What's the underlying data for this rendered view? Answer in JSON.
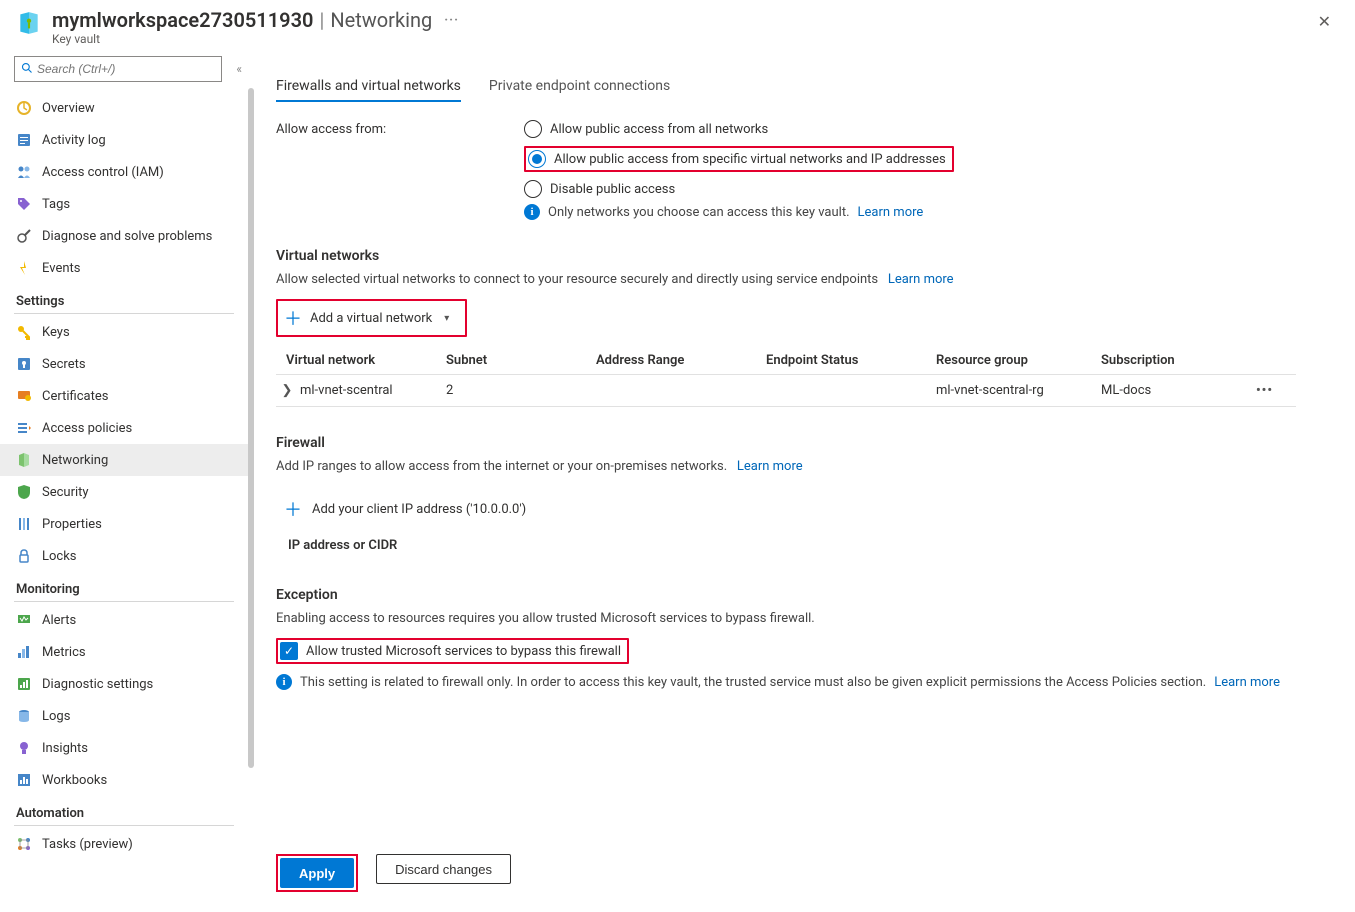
{
  "header": {
    "title": "mymlworkspace2730511930",
    "page": "Networking",
    "subtitle": "Key vault",
    "more": "···"
  },
  "sidebar": {
    "search_placeholder": "Search (Ctrl+/)",
    "top": [
      {
        "label": "Overview",
        "icon": "overview"
      },
      {
        "label": "Activity log",
        "icon": "activity"
      },
      {
        "label": "Access control (IAM)",
        "icon": "iam"
      },
      {
        "label": "Tags",
        "icon": "tags"
      },
      {
        "label": "Diagnose and solve problems",
        "icon": "diag"
      },
      {
        "label": "Events",
        "icon": "events"
      }
    ],
    "groups": [
      {
        "heading": "Settings",
        "items": [
          {
            "label": "Keys",
            "icon": "keys"
          },
          {
            "label": "Secrets",
            "icon": "secrets"
          },
          {
            "label": "Certificates",
            "icon": "certs"
          },
          {
            "label": "Access policies",
            "icon": "acp"
          },
          {
            "label": "Networking",
            "icon": "net",
            "active": true
          },
          {
            "label": "Security",
            "icon": "sec"
          },
          {
            "label": "Properties",
            "icon": "prop"
          },
          {
            "label": "Locks",
            "icon": "locks"
          }
        ]
      },
      {
        "heading": "Monitoring",
        "items": [
          {
            "label": "Alerts",
            "icon": "alerts"
          },
          {
            "label": "Metrics",
            "icon": "metrics"
          },
          {
            "label": "Diagnostic settings",
            "icon": "diagset"
          },
          {
            "label": "Logs",
            "icon": "logs"
          },
          {
            "label": "Insights",
            "icon": "insights"
          },
          {
            "label": "Workbooks",
            "icon": "workbooks"
          }
        ]
      },
      {
        "heading": "Automation",
        "items": [
          {
            "label": "Tasks (preview)",
            "icon": "tasks"
          }
        ]
      }
    ]
  },
  "tabs": {
    "firewalls": "Firewalls and virtual networks",
    "private": "Private endpoint connections"
  },
  "access": {
    "label": "Allow access from:",
    "opt_all": "Allow public access from all networks",
    "opt_specific": "Allow public access from specific virtual networks and IP addresses",
    "opt_disable": "Disable public access",
    "info": "Only networks you choose can access this key vault.",
    "learn_more": "Learn more"
  },
  "vnets": {
    "heading": "Virtual networks",
    "desc": "Allow selected virtual networks to connect to your resource securely and directly using service endpoints",
    "learn_more": "Learn more",
    "add_btn": "Add a virtual network",
    "columns": {
      "vnet": "Virtual network",
      "subnet": "Subnet",
      "range": "Address Range",
      "status": "Endpoint Status",
      "rg": "Resource group",
      "sub": "Subscription"
    },
    "rows": [
      {
        "vnet": "ml-vnet-scentral",
        "subnet": "2",
        "range": "",
        "status": "",
        "rg": "ml-vnet-scentral-rg",
        "sub": "ML-docs"
      }
    ]
  },
  "firewall": {
    "heading": "Firewall",
    "desc": "Add IP ranges to allow access from the internet or your on-premises networks.",
    "learn_more": "Learn more",
    "add_client_ip": "Add your client IP address ('10.0.0.0')",
    "col_ip": "IP address or CIDR"
  },
  "exception": {
    "heading": "Exception",
    "desc": "Enabling access to resources requires you allow trusted Microsoft services to bypass firewall.",
    "checkbox_label": "Allow trusted Microsoft services to bypass this firewall",
    "info": "This setting is related to firewall only. In order to access this key vault, the trusted service must also be given explicit permissions the Access Policies section.",
    "learn_more": "Learn more"
  },
  "buttons": {
    "apply": "Apply",
    "discard": "Discard changes"
  }
}
